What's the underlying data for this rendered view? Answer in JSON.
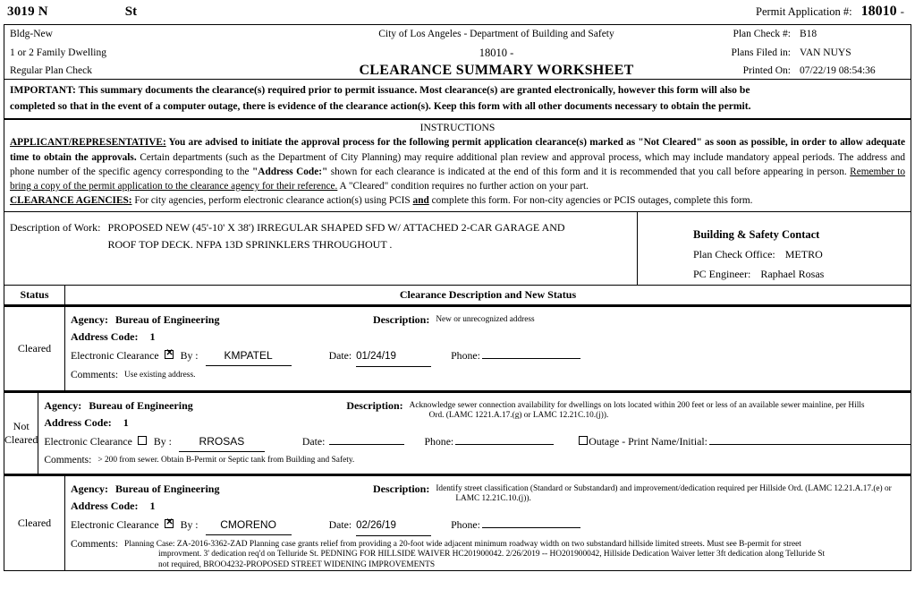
{
  "header": {
    "address_number": "3019 N",
    "address_street_suffix": "St",
    "permit_application_label": "Permit Application #:",
    "permit_application_number": "18010",
    "permit_application_dash": "-"
  },
  "title_band": {
    "left": [
      "Bldg-New",
      "1 or 2 Family Dwelling",
      "Regular Plan Check"
    ],
    "center_line1": "City of Los Angeles - Department of Building and Safety",
    "center_line2": "18010 -",
    "center_line3": "CLEARANCE SUMMARY WORKSHEET",
    "right": [
      {
        "label": "Plan Check #:",
        "value": "B18"
      },
      {
        "label": "Plans Filed in:",
        "value": "VAN NUYS"
      },
      {
        "label": "Printed On:",
        "value": "07/22/19  08:54:36"
      }
    ]
  },
  "important": {
    "lead": "IMPORTANT:",
    "line1": " This summary documents the clearance(s) required prior to permit issuance.  Most clearance(s) are granted electronically, however this form will also be",
    "line2": "completed so that in the event of a computer outage, there is evidence of the clearance action(s).  Keep this form with all other documents necessary to obtain the permit."
  },
  "instructions": {
    "title": "INSTRUCTIONS",
    "applicant_lead": "APPLICANT/REPRESENTATIVE:",
    "applicant_bold_1": " You are advised to initiate the approval process for the following permit application clearance(s) marked as \"Not Cleared\" as soon as possible, in order to allow adequate time to obtain the approvals.",
    "applicant_rest_1": " Certain departments (such as the Department of City Planning) may require additional plan review and approval process, which may include mandatory appeal periods.  The address and phone number of the specific agency corresponding to the ",
    "address_code_bold": "\"Address Code:\"",
    "applicant_rest_2": " shown for each clearance is indicated at the end of this form and it is recommended that you call before appearing in person.  ",
    "remember_underlined": "Remember to bring a copy of the permit application to the clearance agency for their reference.",
    "applicant_rest_3": "  A \"Cleared\" condition requires no further action on your part.",
    "agencies_lead": "CLEARANCE  AGENCIES:",
    "agencies_text_1": " For city agencies, perform electronic clearance action(s) using PCIS ",
    "agencies_and": "and",
    "agencies_text_2": " complete this form. For non-city agencies or PCIS outages, complete this form."
  },
  "description_of_work": {
    "label": "Description of Work:",
    "lines": [
      "PROPOSED NEW (45'-10' X 38') IRREGULAR SHAPED SFD W/ ATTACHED 2-CAR GARAGE AND",
      "ROOF TOP DECK. NFPA 13D SPRINKLERS THROUGHOUT ."
    ]
  },
  "building_safety_contact": {
    "title": "Building & Safety Contact",
    "plan_check_office_label": "Plan Check Office:",
    "plan_check_office_value": "METRO",
    "pc_engineer_label": "PC Engineer:",
    "pc_engineer_value": "Raphael Rosas"
  },
  "table_header": {
    "status": "Status",
    "description": "Clearance Description and New Status"
  },
  "labels": {
    "agency": "Agency:",
    "address_code": "Address Code:",
    "description": "Description:",
    "electronic_clearance": "Electronic Clearance",
    "by": "By :",
    "date": "Date:",
    "phone": "Phone:",
    "comments": "Comments:",
    "outage": "Outage - Print Name/Initial:"
  },
  "clearances": [
    {
      "status": "Cleared",
      "agency": "Bureau of Engineering",
      "address_code": "1",
      "description_lines": [
        "New or unrecognized address"
      ],
      "electronic_checked": true,
      "by": "KMPATEL",
      "date": "01/24/19",
      "phone": "",
      "has_outage_field": false,
      "comments_lines": [
        "Use existing address."
      ]
    },
    {
      "status": "Not Cleared",
      "agency": "Bureau of Engineering",
      "address_code": "1",
      "description_lines": [
        "Acknowledge sewer connection availability for dwellings on lots located within 200 feet or less of an available sewer mainline, per Hills",
        "Ord. (LAMC 1221.A.17.(g) or LAMC 12.21C.10.(j))."
      ],
      "electronic_checked": false,
      "by": "RROSAS",
      "date": "",
      "phone": "",
      "has_outage_field": true,
      "outage_checked": false,
      "outage_value": "",
      "comments_lines": [
        "> 200 from sewer. Obtain B-Permit or Septic tank from Building and Safety."
      ]
    },
    {
      "status": "Cleared",
      "agency": "Bureau of Engineering",
      "address_code": "1",
      "description_lines": [
        "Identify street classification (Standard or Substandard) and improvement/dedication required per Hillside Ord. (LAMC 12.21.A.17.(e) or",
        "LAMC 12.21C.10.(j))."
      ],
      "electronic_checked": true,
      "by": "CMORENO",
      "date": "02/26/19",
      "phone": "",
      "has_outage_field": false,
      "comments_lines": [
        "Planning Case: ZA-2016-3362-ZAD  Planning case grants relief from providing a 20-foot wide adjacent minimum roadway width on two substandard hillside limited streets.  Must see B-permit for street",
        "improvment.    3' dedication req'd on Telluride St.   PEDNING FOR HILLSIDE WAIVER HC201900042.    2/26/2019 -- HO201900042,  Hillside Dedication Waiver letter 3ft dedication along Telluride St",
        "not required,  BROO4232-PROPOSED STREET WIDENING IMPROVEMENTS"
      ]
    }
  ]
}
